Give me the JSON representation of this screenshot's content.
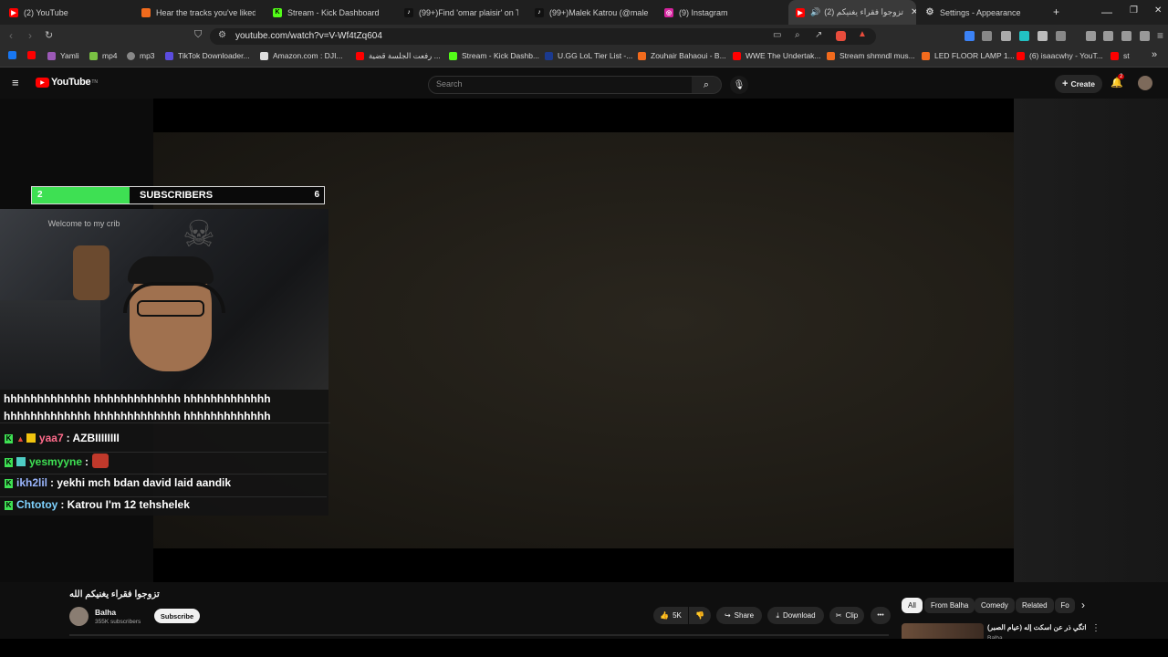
{
  "browser": {
    "tabs": [
      {
        "label": "(2) YouTube",
        "color": "#ff0000"
      },
      {
        "label": "Hear the tracks you've liked: on",
        "color": "#f26b1d"
      },
      {
        "label": "Stream - Kick Dashboard",
        "color": "#53fc18"
      },
      {
        "label": "(99+)Find 'omar plaisir' on TikT",
        "color": "#111111"
      },
      {
        "label": "(99+)Malek Katrou (@malekkat",
        "color": "#111111"
      },
      {
        "label": "(9) Instagram",
        "color": "#d6249f"
      },
      {
        "label": "(2) تزوجوا فقراء يغنيكم",
        "color": "#ff0000",
        "close": "✕"
      },
      {
        "label": "Settings - Appearance",
        "color": "#8ab4f8"
      }
    ],
    "new_tab": "+",
    "window_controls": [
      "—",
      "❐",
      "✕"
    ],
    "url": "youtube.com/watch?v=V-Wf4tZq604",
    "bookmarks": [
      {
        "label": "",
        "color": "#1877f2"
      },
      {
        "label": "",
        "color": "#ff0000"
      },
      {
        "label": "Yamli",
        "color": "#9b59b6"
      },
      {
        "label": "mp4",
        "color": "#7ac143"
      },
      {
        "label": "mp3",
        "color": "#888888"
      },
      {
        "label": "TikTok Downloader...",
        "color": "#5b4cde"
      },
      {
        "label": "Amazon.com : DJI...",
        "color": "#dddddd"
      },
      {
        "label": "رفعت الجلسة قضية ...",
        "color": "#ff0000"
      },
      {
        "label": "Stream - Kick Dashb...",
        "color": "#53fc18"
      },
      {
        "label": "U.GG LoL Tier List -...",
        "color": "#1b3a8f"
      },
      {
        "label": "Zouhair Bahaoui - B...",
        "color": "#f26b1d"
      },
      {
        "label": "WWE The Undertak...",
        "color": "#ff0000"
      },
      {
        "label": "Stream shmndl mus...",
        "color": "#f26b1d"
      },
      {
        "label": "LED FLOOR LAMP 1...",
        "color": "#f26b1d"
      },
      {
        "label": "(6) isaacwhy - YouT...",
        "color": "#ff0000"
      },
      {
        "label": "st",
        "color": "#ff0000"
      }
    ],
    "more_bookmarks": "»"
  },
  "youtube": {
    "logo": "YouTube",
    "logo_sup": "TN",
    "search_placeholder": "Search",
    "create_label": "Create",
    "notif_count": "2"
  },
  "overlay": {
    "sub_goal": {
      "current": "2",
      "label": "SUBSCRIBERS",
      "target": "6",
      "progress": 0.333
    },
    "welcome_text": "Welcome to my crib",
    "chat": [
      {
        "user": "",
        "text": "hhhhhhhhhhhhh hhhhhhhhhhhhh hhhhhhhhhhhhh",
        "user_color": "#ffffff"
      },
      {
        "user": "",
        "text": "hhhhhhhhhhhhh hhhhhhhhhhhhh hhhhhhhhhhhhh",
        "user_color": "#ffffff"
      },
      {
        "user": "yaa7",
        "text": ": AZBIIIIIIII",
        "user_color": "#ff6b8b"
      },
      {
        "user": "yesmyyne",
        "text": ":",
        "user_color": "#3ee053"
      },
      {
        "user": "ikh2lil",
        "text": ": yekhi mch bdan david laid aandik",
        "user_color": "#9bb7ff"
      },
      {
        "user": "Chtotoy",
        "text": ": Katrou I'm 12 tehshelek",
        "user_color": "#7fd3ff"
      }
    ]
  },
  "video_info": {
    "title": "تزوجوا فقراء يغنيكم الله",
    "channel": "Balha",
    "subscribers": "355K subscribers",
    "subscribe_label": "Subscribe",
    "likes": "5K",
    "share_label": "Share",
    "download_label": "Download",
    "clip_label": "Clip",
    "more": "•••"
  },
  "chips": [
    {
      "label": "All",
      "active": true
    },
    {
      "label": "From Balha",
      "active": false
    },
    {
      "label": "Comedy",
      "active": false
    },
    {
      "label": "Related",
      "active": false
    },
    {
      "label": "Fo",
      "active": false
    }
  ],
  "related": {
    "title": "اتگي ذر عن اسكت إله (عيام الصبر)",
    "channel": "Balha"
  }
}
